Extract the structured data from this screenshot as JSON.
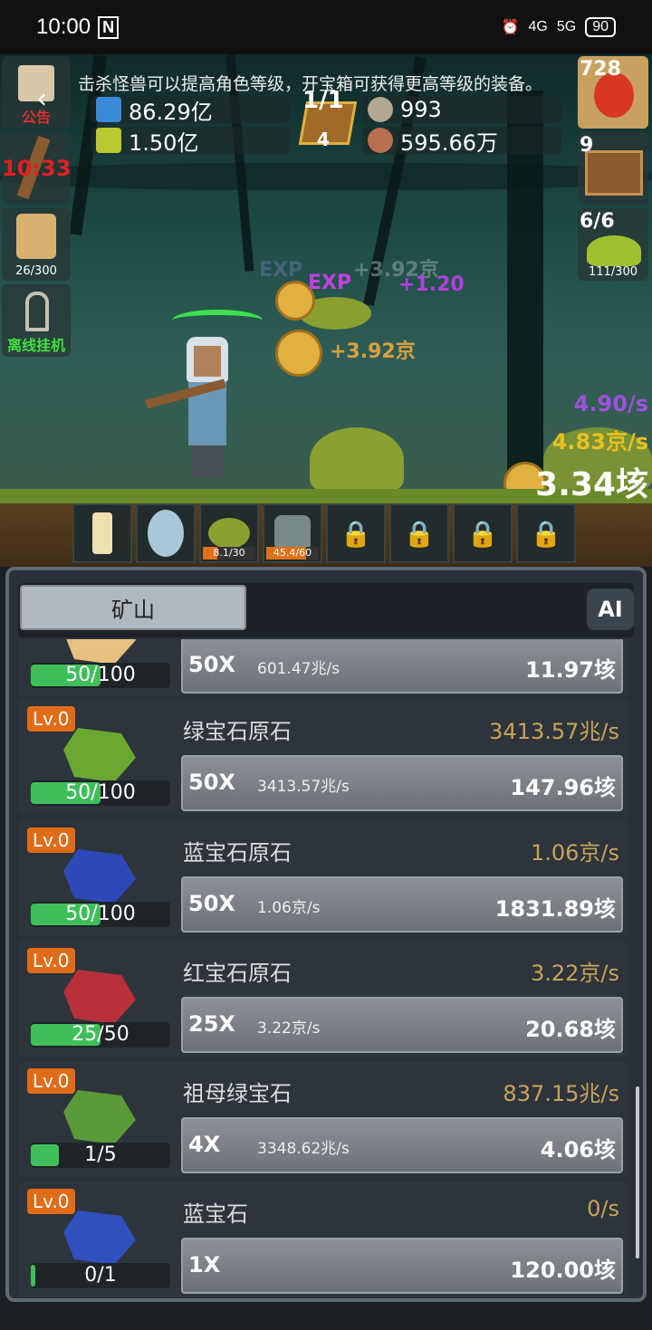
{
  "status": {
    "time": "10:00",
    "nfc": "N",
    "alarm": "⏰",
    "net1": "4G",
    "net2": "5G",
    "battery": "90"
  },
  "notice": "击杀怪兽可以提高角色等级，开宝箱可获得更高等级的装备。",
  "left_buttons": [
    {
      "label": "公告",
      "icon": "scroll-icon"
    },
    {
      "label": "10:33",
      "icon": "torch-icon"
    },
    {
      "label": "26/300",
      "icon": "beer-icon"
    },
    {
      "label": "离线挂机",
      "icon": "key-icon"
    }
  ],
  "resources": {
    "blue_potion": "86.29亿",
    "green_potion": "1.50亿",
    "book_top": "1/1",
    "book_bottom": "4",
    "silver": "993",
    "meat": "595.66万"
  },
  "right_buttons": [
    {
      "value": "728",
      "icon": "potion-icon"
    },
    {
      "value": "9",
      "icon": "chest-icon"
    },
    {
      "value": "6/6",
      "sub": "111/300",
      "icon": "slime-icon"
    }
  ],
  "floats": {
    "f1": "+3.92京",
    "f2": "+1.20",
    "f3": "+3.92京",
    "exp": "EXP",
    "rate_purple": "4.90/s",
    "rate_yellow": "4.83京/s",
    "coin_total": "3.34垓",
    "faded": "+3.92京"
  },
  "slots": [
    {
      "icon": "candle-icon",
      "progress": ""
    },
    {
      "icon": "egg-icon",
      "progress": ""
    },
    {
      "icon": "slime-icon",
      "progress": "8.1/30",
      "fill": 0.27
    },
    {
      "icon": "zombie-icon",
      "progress": "45.4/60",
      "fill": 0.76
    },
    {
      "icon": "lock-icon",
      "progress": ""
    },
    {
      "icon": "lock-icon",
      "progress": ""
    },
    {
      "icon": "lock-icon",
      "progress": ""
    },
    {
      "icon": "lock-icon",
      "progress": ""
    }
  ],
  "panel": {
    "tab": "矿山",
    "ai": "AI",
    "rows": [
      {
        "lv": "",
        "name": "",
        "rate": "",
        "count": "50/100",
        "fill": 0.5,
        "mult": "50X",
        "per": "601.47兆/s",
        "cost": "11.97垓",
        "color": "#e8c080"
      },
      {
        "lv": "Lv.0",
        "name": "绿宝石原石",
        "rate": "3413.57兆/s",
        "count": "50/100",
        "fill": 0.5,
        "mult": "50X",
        "per": "3413.57兆/s",
        "cost": "147.96垓",
        "color": "#6aa832"
      },
      {
        "lv": "Lv.0",
        "name": "蓝宝石原石",
        "rate": "1.06京/s",
        "count": "50/100",
        "fill": 0.5,
        "mult": "50X",
        "per": "1.06京/s",
        "cost": "1831.89垓",
        "color": "#2e48b8"
      },
      {
        "lv": "Lv.0",
        "name": "红宝石原石",
        "rate": "3.22京/s",
        "count": "25/50",
        "fill": 0.5,
        "mult": "25X",
        "per": "3.22京/s",
        "cost": "20.68垓",
        "color": "#b8303a"
      },
      {
        "lv": "Lv.0",
        "name": "祖母绿宝石",
        "rate": "837.15兆/s",
        "count": "1/5",
        "fill": 0.2,
        "mult": "4X",
        "per": "3348.62兆/s",
        "cost": "4.06垓",
        "color": "#5a9a38"
      },
      {
        "lv": "Lv.0",
        "name": "蓝宝石",
        "rate": "0/s",
        "count": "0/1",
        "fill": 0.03,
        "mult": "1X",
        "per": "",
        "cost": "120.00垓",
        "color": "#3050c0"
      }
    ]
  }
}
